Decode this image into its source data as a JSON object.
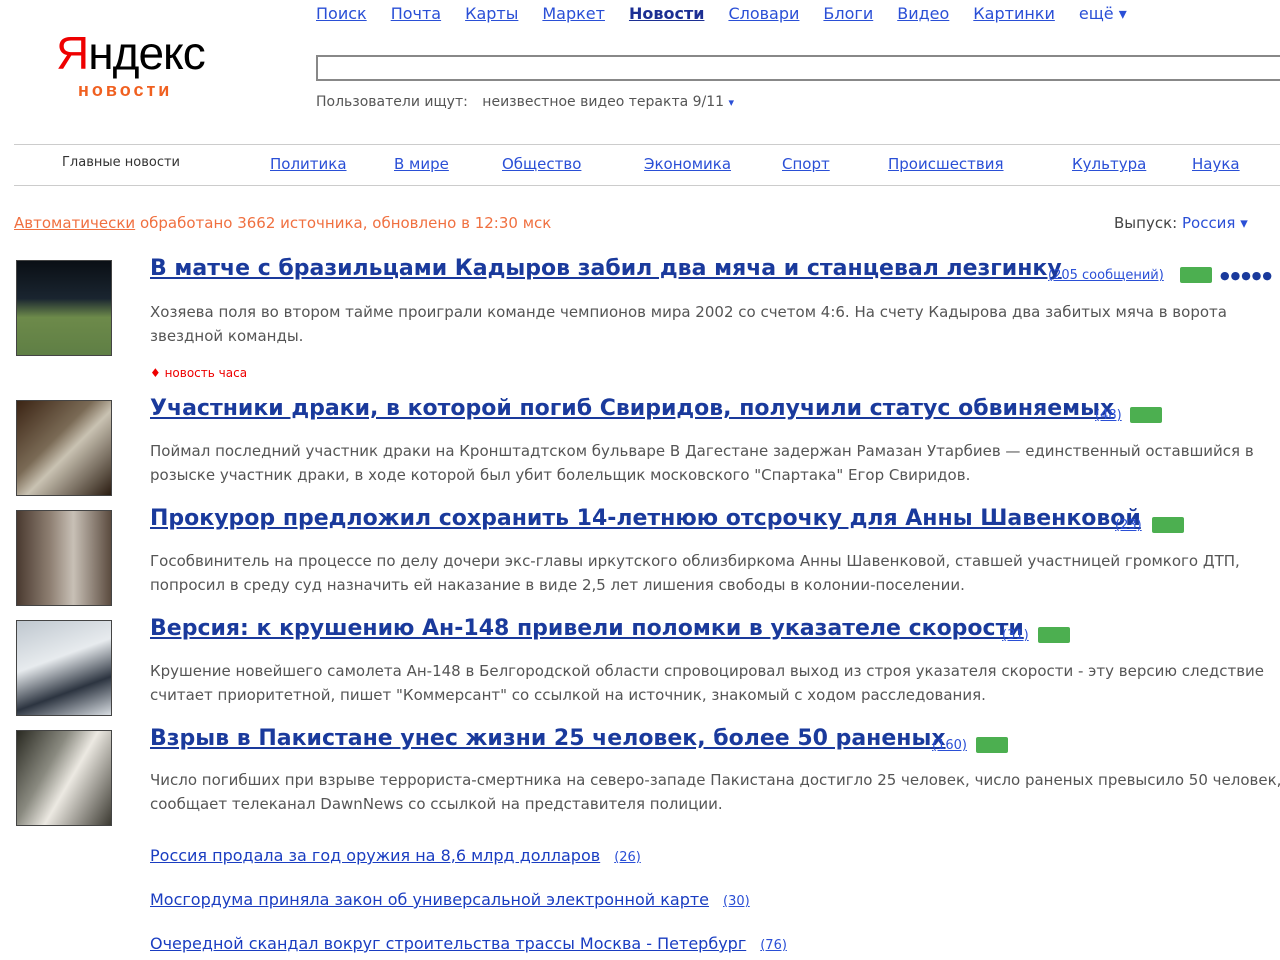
{
  "logo": {
    "first_letter": "Я",
    "rest": "ндекс",
    "subtitle": "новости"
  },
  "services": [
    "Поиск",
    "Почта",
    "Карты",
    "Маркет",
    "Новости",
    "Словари",
    "Блоги",
    "Видео",
    "Картинки",
    "ещё"
  ],
  "search": {
    "value": "",
    "hint_label": "Пользователи ищут:",
    "hint_query": "неизвестное видео теракта 9/11"
  },
  "nav": {
    "current": "Главные новости",
    "items": [
      "Политика",
      "В мире",
      "Общество",
      "Экономика",
      "Спорт",
      "Происшествия",
      "Культура",
      "Наука"
    ]
  },
  "status": {
    "link": "Автоматически",
    "text": "обработано 3662 источника, обновлено в 12:30 мск"
  },
  "edition": {
    "label": "Выпуск:",
    "value": "Россия"
  },
  "new_label": "новость часа",
  "stories": [
    {
      "headline": "В матче с бразильцами Кадыров забил два мяча и станцевал лезгинку",
      "meta": "(205 сообщений)",
      "snippet": "Хозяева поля во втором тайме проиграли команде чемпионов мира 2002 со счетом 4:6. На счету Кадырова два забитых мяча в ворота звездной команды."
    },
    {
      "headline": "Участники драки, в которой погиб Свиридов, получили статус обвиняемых",
      "meta": "(48)",
      "snippet": "Поймал последний участник драки на Кронштадтском бульваре В Дагестане задержан Рамазан Утарбиев — единственный оставшийся в розыске участник драки, в ходе которой был убит болельщик московского \"Спартака\" Егор Свиридов."
    },
    {
      "headline": "Прокурор предложил сохранить 14-летнюю отсрочку для Анны Шавенковой",
      "meta": "(23)",
      "snippet": "Гособвинитель на процессе по делу дочери экс-главы иркутского облизбиркома Анны Шавенковой, ставшей участницей громкого ДТП, попросил в среду суд назначить ей наказание в виде 2,5 лет лишения свободы в колонии-поселении."
    },
    {
      "headline": "Версия: к крушению Ан-148 привели поломки в указателе скорости",
      "meta": "(31)",
      "snippet": "Крушение новейшего самолета Ан-148 в Белгородской области спровоцировал выход из строя указателя скорости - эту версию следствие считает приоритетной, пишет \"Коммерсант\" со ссылкой на источник, знакомый с ходом расследования."
    },
    {
      "headline": "Взрыв в Пакистане унес жизни 25 человек, более 50 раненых",
      "meta": "(160)",
      "snippet": "Число погибших при взрыве террориста-смертника на северо-западе Пакистана достигло 25 человек, число раненых превысило 50 человек, сообщает телеканал DawnNews со ссылкой на представителя полиции."
    }
  ],
  "more_stories": [
    {
      "title": "Россия продала за год оружия на 8,6 млрд долларов",
      "count": "(26)"
    },
    {
      "title": "Мосгордума приняла закон об универсальной электронной карте",
      "count": "(30)"
    },
    {
      "title": "Очередной скандал вокруг строительства трассы Москва - Петербург",
      "count": "(76)"
    }
  ]
}
